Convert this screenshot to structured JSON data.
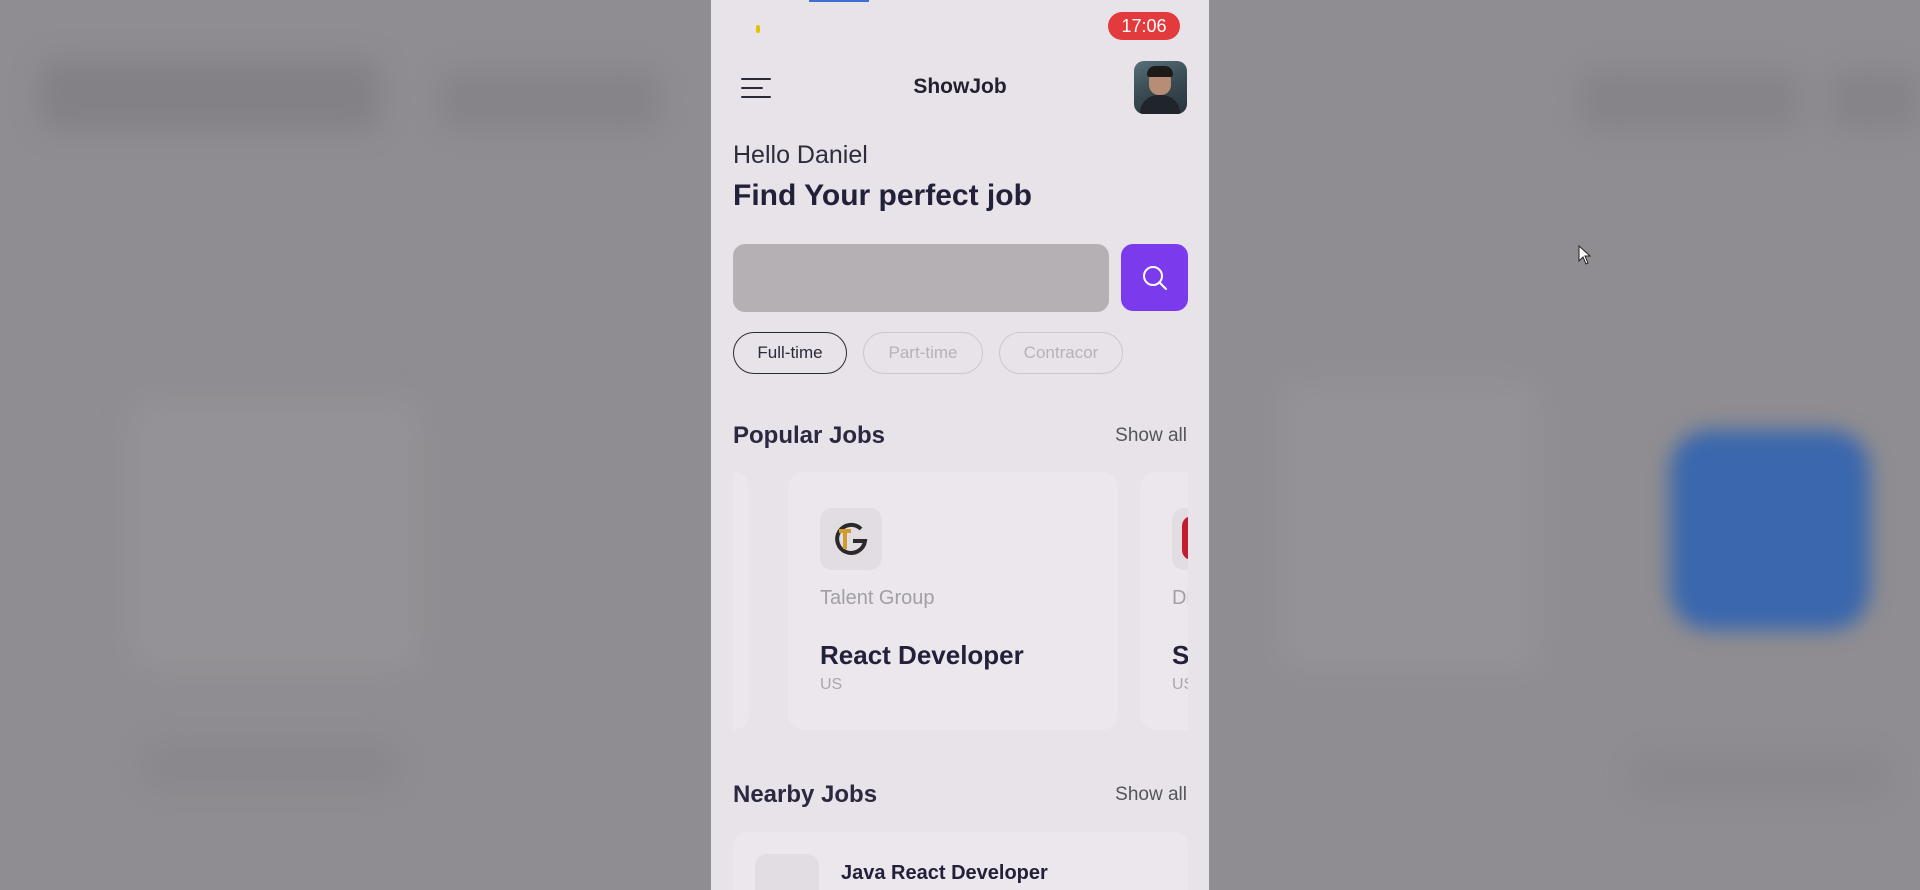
{
  "status": {
    "time": "17:06"
  },
  "header": {
    "title": "ShowJob"
  },
  "greeting": "Hello Daniel",
  "headline": "Find Your perfect job",
  "search": {
    "placeholder": ""
  },
  "filters": [
    {
      "label": "Full-time",
      "active": true
    },
    {
      "label": "Part-time",
      "active": false
    },
    {
      "label": "Contracor",
      "active": false
    }
  ],
  "popular": {
    "title": "Popular Jobs",
    "show_all": "Show all",
    "cards": [
      {
        "company": "Talent Group",
        "title": "React Developer",
        "location": "US"
      },
      {
        "company": "Dic",
        "title": "Se",
        "location": "US"
      }
    ]
  },
  "nearby": {
    "title": "Nearby Jobs",
    "show_all": "Show all",
    "items": [
      {
        "title": "Java React Developer"
      }
    ]
  },
  "colors": {
    "accent": "#7c3aed",
    "time_pill": "#e23a3d",
    "brand_red": "#c21d2e"
  }
}
